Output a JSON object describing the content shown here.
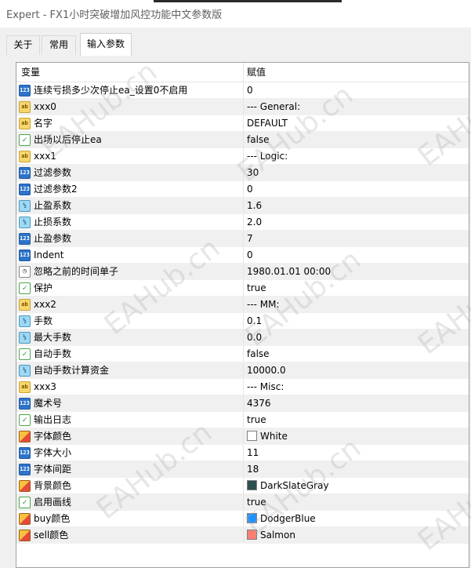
{
  "window": {
    "title": "Expert - FX1小时突破增加风控功能中文参数版"
  },
  "tabs": [
    {
      "label": "关于"
    },
    {
      "label": "常用"
    },
    {
      "label": "输入参数"
    }
  ],
  "table": {
    "headers": {
      "variable": "变量",
      "value": "赋值"
    },
    "rows": [
      {
        "icon": "int-type-icon",
        "type": "int",
        "name": "连续亏损多少次停止ea_设置0不启用",
        "value": "0"
      },
      {
        "icon": "string-type-icon",
        "type": "str",
        "name": "xxx0",
        "value": "--- General:"
      },
      {
        "icon": "string-type-icon",
        "type": "str",
        "name": "名字",
        "value": "DEFAULT"
      },
      {
        "icon": "bool-type-icon",
        "type": "bool",
        "name": "出场以后停止ea",
        "value": "false"
      },
      {
        "icon": "string-type-icon",
        "type": "str",
        "name": "xxx1",
        "value": "--- Logic:"
      },
      {
        "icon": "int-type-icon",
        "type": "int",
        "name": "过滤参数",
        "value": "30"
      },
      {
        "icon": "int-type-icon",
        "type": "int",
        "name": "过滤参数2",
        "value": "0"
      },
      {
        "icon": "double-type-icon",
        "type": "dbl",
        "name": "止盈系数",
        "value": "1.6"
      },
      {
        "icon": "double-type-icon",
        "type": "dbl",
        "name": "止损系数",
        "value": "2.0"
      },
      {
        "icon": "int-type-icon",
        "type": "int",
        "name": "止盈参数",
        "value": "7"
      },
      {
        "icon": "int-type-icon",
        "type": "int",
        "name": "Indent",
        "value": "0"
      },
      {
        "icon": "datetime-type-icon",
        "type": "time",
        "name": "忽略之前的时间单子",
        "value": "1980.01.01 00:00"
      },
      {
        "icon": "bool-type-icon",
        "type": "bool",
        "name": "保护",
        "value": "true"
      },
      {
        "icon": "string-type-icon",
        "type": "str",
        "name": "xxx2",
        "value": "--- MM:"
      },
      {
        "icon": "double-type-icon",
        "type": "dbl",
        "name": "手数",
        "value": "0.1"
      },
      {
        "icon": "double-type-icon",
        "type": "dbl",
        "name": "最大手数",
        "value": "0.0"
      },
      {
        "icon": "bool-type-icon",
        "type": "bool",
        "name": "自动手数",
        "value": "false"
      },
      {
        "icon": "double-type-icon",
        "type": "dbl",
        "name": "自动手数计算资金",
        "value": "10000.0"
      },
      {
        "icon": "string-type-icon",
        "type": "str",
        "name": "xxx3",
        "value": "--- Misc:"
      },
      {
        "icon": "int-type-icon",
        "type": "int",
        "name": "魔术号",
        "value": "4376"
      },
      {
        "icon": "bool-type-icon",
        "type": "bool",
        "name": "输出日志",
        "value": "true"
      },
      {
        "icon": "color-type-icon",
        "type": "color",
        "name": "字体颜色",
        "value": "White",
        "swatch": "#ffffff"
      },
      {
        "icon": "int-type-icon",
        "type": "int",
        "name": "字体大小",
        "value": "11"
      },
      {
        "icon": "int-type-icon",
        "type": "int",
        "name": "字体间距",
        "value": "18"
      },
      {
        "icon": "color-type-icon",
        "type": "color",
        "name": "背景颜色",
        "value": "DarkSlateGray",
        "swatch": "#2f4f4f"
      },
      {
        "icon": "bool-type-icon",
        "type": "bool",
        "name": "启用画线",
        "value": "true"
      },
      {
        "icon": "color-type-icon",
        "type": "color",
        "name": "buy颜色",
        "value": "DodgerBlue",
        "swatch": "#1e90ff"
      },
      {
        "icon": "color-type-icon",
        "type": "color",
        "name": "sell颜色",
        "value": "Salmon",
        "swatch": "#fa8072"
      }
    ]
  },
  "watermark": "EAHub.cn"
}
